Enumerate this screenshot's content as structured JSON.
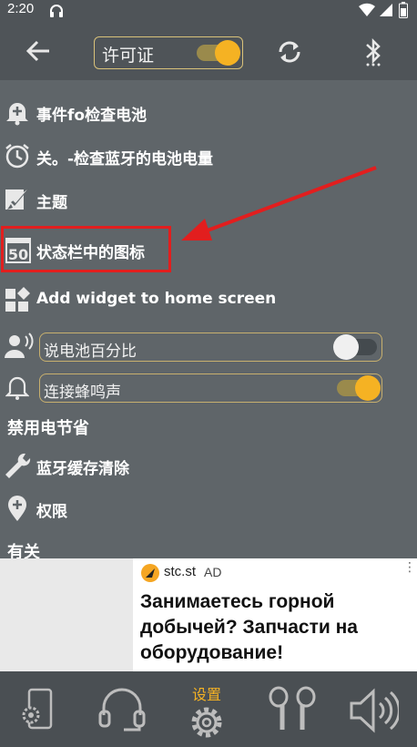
{
  "status_bar": {
    "time": "2:20"
  },
  "toolbar": {
    "license_label": "许可证",
    "license_on": true
  },
  "menu": {
    "event_check": "事件fo检查电池",
    "off_check": "关。-检查蓝牙的电池电量",
    "theme": "主题",
    "statusbar_icon": "状态栏中的图标",
    "add_widget": "Add widget to home screen",
    "speak_percent": "说电池百分比",
    "speak_percent_on": false,
    "connect_beep": "连接蜂鸣声",
    "connect_beep_on": true,
    "disable_power_saving": "禁用电节省",
    "bluetooth_cache": "蓝牙缓存清除",
    "permissions": "权限",
    "about": "有关"
  },
  "statusbar_icon_number": "50",
  "ad": {
    "brand": "stc.st",
    "tag": "AD",
    "menu": "⋮",
    "headline": "Занимаетесь горной добычей? Запчасти на оборудование!"
  },
  "bottom_nav": {
    "settings_label": "设置",
    "active": "settings"
  },
  "colors": {
    "accent": "#f5b223",
    "background": "#5f6569",
    "highlight": "#e21e1e"
  }
}
